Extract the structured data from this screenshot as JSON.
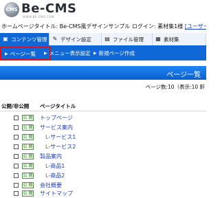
{
  "logo": {
    "mark": "CMS",
    "name": "Be-CMS",
    "tagline": "WWW.BE-CMS.COM"
  },
  "info_bar": {
    "text": "ホームページタイトル: Be-CMS風デザインサンプル  ログイン: 素材集1様 ",
    "user_link": "[ユーザー情報"
  },
  "tabs": [
    {
      "label": "コンテンツ管理",
      "icon": "content-icon"
    },
    {
      "label": "デザイン設定",
      "icon": "design-icon"
    },
    {
      "label": "ファイル管理",
      "icon": "folder-icon"
    },
    {
      "label": "素材集",
      "icon": "material-icon"
    }
  ],
  "subnav": [
    {
      "label": "ページ一覧"
    },
    {
      "label": "メニュー表示設定"
    },
    {
      "label": "新規ページ作成"
    }
  ],
  "title": "ページ一覧",
  "count_line": "ページ数:10（表示:10 軒",
  "table": {
    "headers": [
      "公開/非公開",
      "ページタイトル"
    ],
    "badge": "公 開",
    "rows": [
      {
        "prefix": "",
        "title": "トップページ"
      },
      {
        "prefix": "",
        "title": "サービス案内"
      },
      {
        "prefix": "L",
        "title": "サービス1"
      },
      {
        "prefix": "L",
        "title": "サービス2"
      },
      {
        "prefix": "",
        "title": "製品案内"
      },
      {
        "prefix": "L",
        "title": "商品1"
      },
      {
        "prefix": "L",
        "title": "商品2"
      },
      {
        "prefix": "",
        "title": "会社概要"
      },
      {
        "prefix": "",
        "title": "サイトマップ"
      }
    ]
  },
  "colors": {
    "accent_blue": "#0f68d6",
    "highlight_red": "#e0121b",
    "badge_green": "#3f9b39",
    "link_blue": "#1a3cb8"
  }
}
